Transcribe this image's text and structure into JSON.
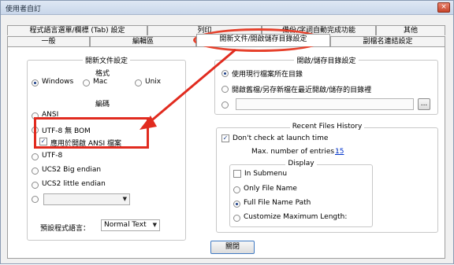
{
  "window": {
    "title": "使用者自訂",
    "close_icon": "×"
  },
  "tabs_row1": [
    "程式語言選單/欄標 (Tab) 設定",
    "列印",
    "備份/字詞自動完成功能",
    "其他"
  ],
  "tabs_row2": [
    "一般",
    "編輯區",
    "開新文件/開啟儲存目錄設定",
    "副檔名連結設定"
  ],
  "new_doc": {
    "title": "開新文件設定",
    "format_title": "格式",
    "format_options": [
      "Windows",
      "Mac",
      "Unix"
    ],
    "encoding_title": "編碼",
    "encodings": [
      "ANSI",
      "UTF-8 無 BOM",
      "應用於開啟 ANSI 檔案",
      "UTF-8",
      "UCS2 Big endian",
      "UCS2 little endian"
    ],
    "default_lang_label": "預設程式語言：",
    "default_lang_value": "Normal Text"
  },
  "open_save": {
    "title": "開啟/儲存目錄設定",
    "options": [
      "使用現行檔案所在目錄",
      "開啟舊檔/另存新檔在最近開啟/儲存的目錄裡"
    ],
    "browse_label": "..."
  },
  "recent": {
    "title": "Recent Files History",
    "dont_check": "Don't check at launch time",
    "max_label": "Max. number of entries :",
    "max_value": "15",
    "display_title": "Display",
    "in_submenu": "In Submenu",
    "display_options": [
      "Only File Name",
      "Full File Name Path",
      "Customize Maximum Length:"
    ]
  },
  "close_button": "關閉",
  "accent_color": "#e12b1f"
}
